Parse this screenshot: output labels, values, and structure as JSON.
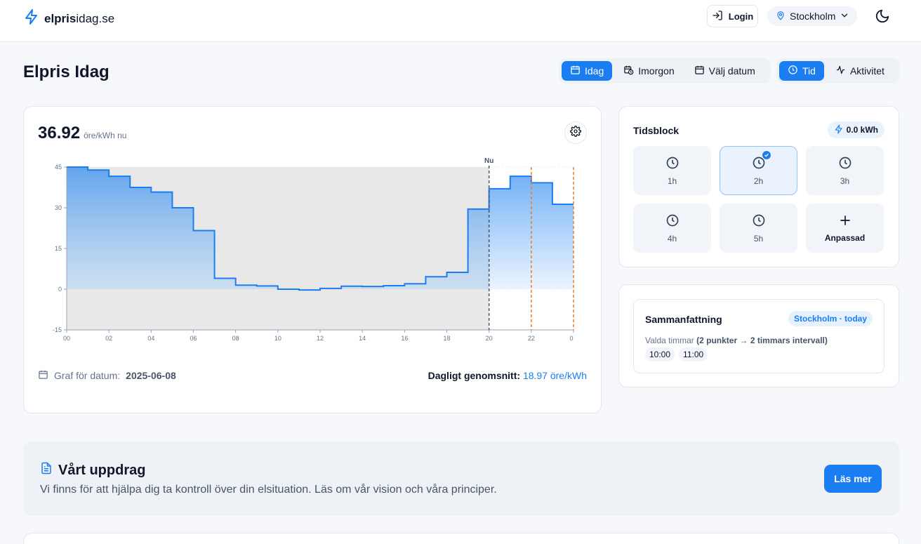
{
  "header": {
    "brand_bold": "elpris",
    "brand_rest": "idag.se",
    "login_label": "Login",
    "location": "Stockholm",
    "icons": [
      "lightning-icon",
      "login-icon",
      "map-pin-icon",
      "chevron-down-icon",
      "moon-icon"
    ]
  },
  "page": {
    "title": "Elpris Idag"
  },
  "date_tabs": [
    {
      "label": "Idag",
      "active": true
    },
    {
      "label": "Imorgon",
      "active": false
    },
    {
      "label": "Välj datum",
      "active": false
    }
  ],
  "mode_tabs": [
    {
      "label": "Tid",
      "active": true
    },
    {
      "label": "Aktivitet",
      "active": false
    }
  ],
  "current": {
    "price": "36.92",
    "unit": "öre/kWh nu"
  },
  "colors": {
    "accent": "#1a7ef2",
    "now_line": "#475569",
    "window_line": "#ea7c2a"
  },
  "chart_data": {
    "type": "area",
    "step": true,
    "x": [
      "00",
      "01",
      "02",
      "03",
      "04",
      "05",
      "06",
      "07",
      "08",
      "09",
      "10",
      "11",
      "12",
      "13",
      "14",
      "15",
      "16",
      "17",
      "18",
      "19",
      "20",
      "21",
      "22",
      "23"
    ],
    "values": [
      45,
      43.9,
      41.6,
      37.5,
      35.8,
      30,
      21.6,
      4,
      1.5,
      1.2,
      0,
      -0.3,
      0.3,
      1.1,
      1,
      1.3,
      2,
      4.6,
      6.2,
      29.5,
      37,
      41.6,
      39.2,
      31.3
    ],
    "ylim": [
      -15,
      45
    ],
    "yticks": [
      45,
      30,
      15,
      0,
      -15
    ],
    "xticks": [
      "00",
      "02",
      "04",
      "06",
      "08",
      "10",
      "12",
      "14",
      "16",
      "18",
      "20",
      "22",
      "0"
    ],
    "now_label": "Nu",
    "now_hour": 20,
    "window_lines": [
      22,
      24
    ],
    "grid": true
  },
  "footer": {
    "date_label": "Graf för datum:",
    "date_value": "2025-06-08",
    "avg_label": "Dagligt genomsnitt:",
    "avg_value": "18.97 öre/kWh"
  },
  "tidsblock": {
    "title": "Tidsblock",
    "kwh": "0.0 kWh",
    "tiles": [
      {
        "label": "1h",
        "selected": false
      },
      {
        "label": "2h",
        "selected": true
      },
      {
        "label": "3h",
        "selected": false
      },
      {
        "label": "4h",
        "selected": false
      },
      {
        "label": "5h",
        "selected": false
      },
      {
        "label": "Anpassad",
        "selected": false
      }
    ]
  },
  "summary": {
    "title": "Sammanfattning",
    "badge": "Stockholm · today",
    "sub_prefix": "Valda timmar",
    "sub_detail": "(2 punkter → 2 timmars intervall)",
    "hours": [
      "10:00",
      "11:00"
    ]
  },
  "mission": {
    "title": "Vårt uppdrag",
    "text": "Vi finns för att hjälpa dig ta kontroll över din elsituation. Läs om vår vision och våra principer.",
    "button": "Läs mer"
  }
}
